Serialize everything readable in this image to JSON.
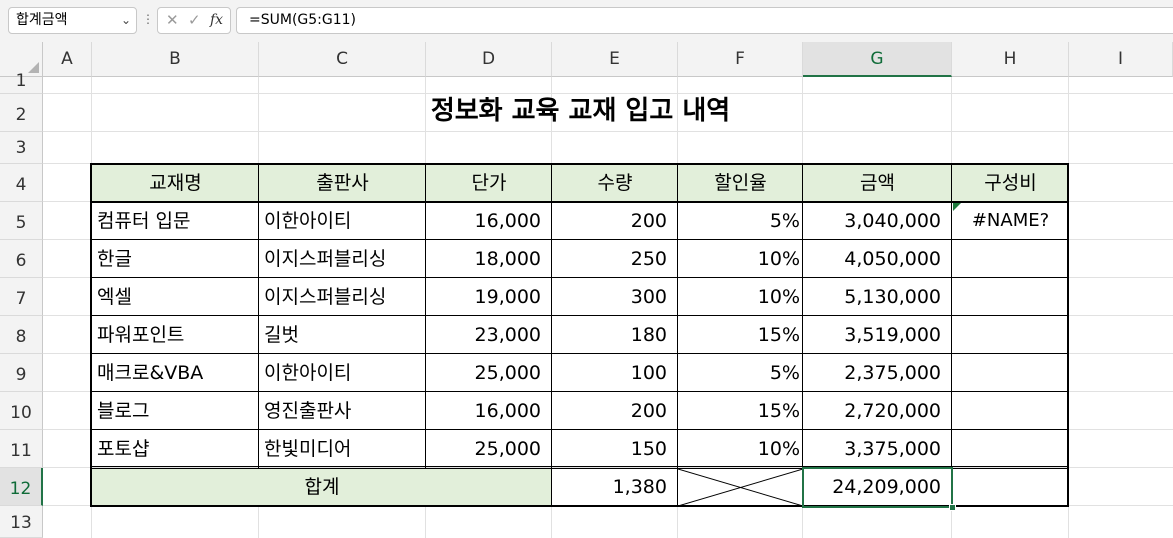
{
  "name_box": "합계금액",
  "formula": "=SUM(G5:G11)",
  "columns": [
    "A",
    "B",
    "C",
    "D",
    "E",
    "F",
    "G",
    "H",
    "I"
  ],
  "rows": [
    "1",
    "2",
    "3",
    "4",
    "5",
    "6",
    "7",
    "8",
    "9",
    "10",
    "11",
    "12",
    "13"
  ],
  "title": "정보화 교육 교재 입고 내역",
  "headers": [
    "교재명",
    "출판사",
    "단가",
    "수량",
    "할인율",
    "금액",
    "구성비"
  ],
  "data": [
    [
      "컴퓨터 입문",
      "이한아이티",
      "16,000",
      "200",
      "5%",
      "3,040,000",
      "#NAME?"
    ],
    [
      "한글",
      "이지스퍼블리싱",
      "18,000",
      "250",
      "10%",
      "4,050,000",
      ""
    ],
    [
      "엑셀",
      "이지스퍼블리싱",
      "19,000",
      "300",
      "10%",
      "5,130,000",
      ""
    ],
    [
      "파워포인트",
      "길벗",
      "23,000",
      "180",
      "15%",
      "3,519,000",
      ""
    ],
    [
      "매크로&VBA",
      "이한아이티",
      "25,000",
      "100",
      "5%",
      "2,375,000",
      ""
    ],
    [
      "블로그",
      "영진출판사",
      "16,000",
      "200",
      "15%",
      "2,720,000",
      ""
    ],
    [
      "포토샵",
      "한빛미디어",
      "25,000",
      "150",
      "10%",
      "3,375,000",
      ""
    ]
  ],
  "total": {
    "label": "합계",
    "qty": "1,380",
    "amount": "24,209,000"
  },
  "icons": {
    "cancel": "cancel-icon",
    "confirm": "check-icon",
    "function": "fx-icon"
  },
  "accent_color": "#217346",
  "header_fill": "#e2efda"
}
